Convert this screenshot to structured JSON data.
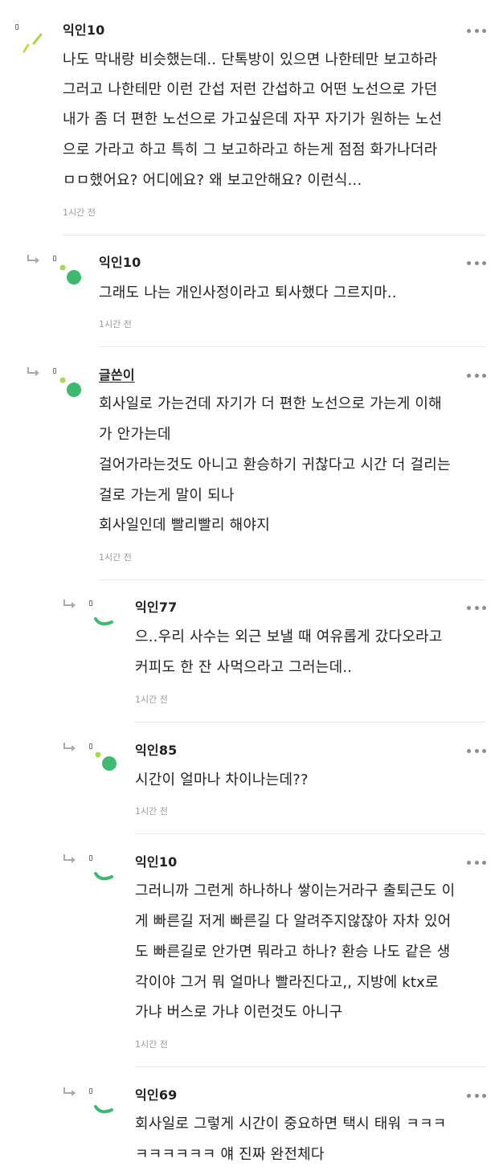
{
  "comments": [
    {
      "author": "익인10",
      "lines": [
        "나도 막내랑 비슷했는데.. 단톡방이 있으면 나한테만 보고하라",
        "그러고 나한테만 이런 간섭 저런 간섭하고 어떤 노선으로 가던",
        "내가 좀 더 편한 노선으로 가고싶은데 자꾸 자기가 원하는 노선",
        "으로 가라고 하고 특히 그 보고하라고 하는게 점점 화가나더라",
        "ㅁㅁ했어요? 어디에요? 왜 보고안해요? 이런식..."
      ],
      "time": "1시간 전",
      "avatar": "yellow-green-sticks"
    },
    {
      "author": "익인10",
      "lines": [
        "그래도 나는 개인사정이라고 퇴사했다 그르지마.."
      ],
      "time": "1시간 전",
      "avatar": "green-dots"
    },
    {
      "author": "글쓴이",
      "lines": [
        "회사일로 가는건데 자기가 더 편한 노선으로 가는게 이해",
        "가 안가는데",
        "걸어가라는것도 아니고 환승하기 귀찮다고 시간 더 걸리는",
        "걸로 가는게 말이 되나",
        "회사일인데 빨리빨리 해야지"
      ],
      "time": "1시간 전",
      "avatar": "green-dots"
    },
    {
      "author": "익인77",
      "lines": [
        "으..우리 사수는 외근 보낼 때 여유롭게 갔다오라고",
        "커피도 한 잔 사먹으라고 그러는데.."
      ],
      "time": "1시간 전",
      "avatar": "green-arc"
    },
    {
      "author": "익인85",
      "lines": [
        "시간이 얼마나 차이나는데??"
      ],
      "time": "1시간 전",
      "avatar": "green-dots"
    },
    {
      "author": "익인10",
      "lines": [
        "그러니까 그런게 하나하나 쌓이는거라구 출퇴근도 이",
        "게 빠른길 저게 빠른길 다 알려주지않잖아 자차 있어",
        "도 빠른길로 안가면 뭐라고 하나? 환승 나도 같은 생",
        "각이야 그거 뭐 얼마나 빨라진다고,, 지방에 ktx로",
        "가냐 버스로 가냐 이런것도 아니구"
      ],
      "time": "1시간 전",
      "avatar": "green-arc"
    },
    {
      "author": "익인69",
      "lines": [
        "회사일로 그렇게 시간이 중요하면 택시 태워 ㅋㅋㅋ",
        "ㅋㅋㅋㅋㅋㅋ 얘 진짜 완전체다"
      ],
      "time": "",
      "avatar": "green-arc"
    }
  ],
  "colors": {
    "avatar_green": "#3dba6f",
    "avatar_lightgreen": "#a6d94b",
    "avatar_yellow": "#c9d93a"
  }
}
